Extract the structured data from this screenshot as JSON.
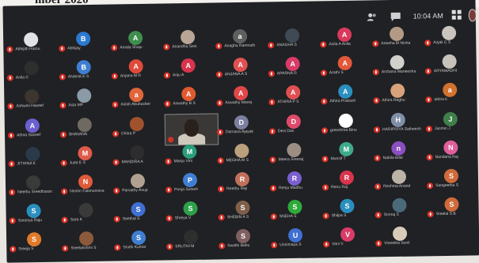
{
  "header_fragment": "mber 2020",
  "topbar": {
    "clock": "10:04 AM",
    "icons": [
      "people-icon",
      "chat-icon",
      "grid-icon"
    ]
  },
  "participants": [
    {
      "name": "Abhijith Ramu",
      "initial": "",
      "color": "#dfe3e6"
    },
    {
      "name": "Abhijay",
      "initial": "B",
      "color": "#2b79d0"
    },
    {
      "name": "Amala Shaju",
      "initial": "A",
      "color": "#3e8e4e"
    },
    {
      "name": "Anandha Sesi",
      "initial": "",
      "color": "#b8a596"
    },
    {
      "name": "Anagha Ramnath",
      "initial": "a",
      "color": "#5f5f5f"
    },
    {
      "name": "ANAGHA S",
      "initial": "",
      "color": "#3f4a55"
    },
    {
      "name": "Anila A Anila",
      "initial": "A",
      "color": "#d93a5c"
    },
    {
      "name": "Aneeha M Nisha",
      "initial": "",
      "color": "#b39a85"
    },
    {
      "name": "Anjali C S",
      "initial": "",
      "color": "#c9c4bd"
    },
    {
      "name": "Anila C",
      "initial": "",
      "color": "#2e2e2e"
    },
    {
      "name": "ANAHA K S",
      "initial": "B",
      "color": "#3f7fd1"
    },
    {
      "name": "Anjana M R",
      "initial": "A",
      "color": "#e04a3a"
    },
    {
      "name": "Anju A",
      "initial": "A",
      "color": "#d8344d"
    },
    {
      "name": "ANJANA A S",
      "initial": "A",
      "color": "#e05252"
    },
    {
      "name": "APARNA R",
      "initial": "A",
      "color": "#d83b67"
    },
    {
      "name": "Arathi S",
      "initial": "A",
      "color": "#e2583a"
    },
    {
      "name": "Archana Maneesha",
      "initial": "",
      "color": "#d2d0cc"
    },
    {
      "name": "ARYAMADHI",
      "initial": "",
      "color": "#c7c2ba"
    },
    {
      "name": "Ashwini Haseef",
      "initial": "",
      "color": "#3c3530"
    },
    {
      "name": "Asla MP",
      "initial": "",
      "color": "#8a9aa6"
    },
    {
      "name": "Aslah Abubucker",
      "initial": "a",
      "color": "#e0663a"
    },
    {
      "name": "Aswathy B S",
      "initial": "A",
      "color": "#e05a30"
    },
    {
      "name": "Aswathy Manoj",
      "initial": "A",
      "color": "#e04848"
    },
    {
      "name": "ATHIRA P S",
      "initial": "A",
      "color": "#e05050"
    },
    {
      "name": "Athira Prakash",
      "initial": "A",
      "color": "#2a8fbf"
    },
    {
      "name": "Athira Reghu",
      "initial": "",
      "color": "#d9a27a"
    },
    {
      "name": "athira k",
      "initial": "a",
      "color": "#d2722f"
    },
    {
      "name": "Athira Saseef",
      "initial": "A",
      "color": "#6b5fd1"
    },
    {
      "name": "BHAVANA",
      "initial": "",
      "color": "#6e6a62"
    },
    {
      "name": "Chitra P",
      "initial": "",
      "color": "#a0522d"
    },
    {
      "name": "",
      "initial": "",
      "color": "",
      "video": true
    },
    {
      "name": "Darsana Ajayak",
      "initial": "D",
      "color": "#7c7fa0"
    },
    {
      "name": "Devi Das",
      "initial": "D",
      "color": "#e04a6a"
    },
    {
      "name": "greeshma Binu",
      "initial": "",
      "color": "#ffffff"
    },
    {
      "name": "HARIPRIYA Satheesh",
      "initial": "H",
      "color": "#7f8fa7"
    },
    {
      "name": "Jasmin J",
      "initial": "J",
      "color": "#3f7f4a"
    },
    {
      "name": "JITHINA K",
      "initial": "",
      "color": "#2a3a4a"
    },
    {
      "name": "Juda E S",
      "initial": "M",
      "color": "#e05a4a"
    },
    {
      "name": "MANDIRA A",
      "initial": "",
      "color": "#2d2d2d"
    },
    {
      "name": "Manju Vini",
      "initial": "M",
      "color": "#2a9f7a"
    },
    {
      "name": "MEGHA M S",
      "initial": "",
      "color": "#bba07d"
    },
    {
      "name": "Meera Sreeraj",
      "initial": "",
      "color": "#9c8e82"
    },
    {
      "name": "Munsif T",
      "initial": "M",
      "color": "#3faa8a"
    },
    {
      "name": "Nabila Bilal",
      "initial": "n",
      "color": "#8a4fc0"
    },
    {
      "name": "Nandana Raj",
      "initial": "N",
      "color": "#e05f9a"
    },
    {
      "name": "Neethu Sreedharan",
      "initial": "",
      "color": "#3a3a3a"
    },
    {
      "name": "Noorin Fatimunnisa",
      "initial": "N",
      "color": "#e05a3a"
    },
    {
      "name": "Parvathy Anup",
      "initial": "",
      "color": "#b0a090"
    },
    {
      "name": "Pooja Suresh",
      "initial": "P",
      "color": "#3f7fd1"
    },
    {
      "name": "Reethu Reji",
      "initial": "R",
      "color": "#c0705a"
    },
    {
      "name": "Renju Madhu",
      "initial": "R",
      "color": "#7a5fd1"
    },
    {
      "name": "Renu Raj",
      "initial": "R",
      "color": "#d8344d"
    },
    {
      "name": "Reshma Anand",
      "initial": "",
      "color": "#bbb3a6"
    },
    {
      "name": "Sangeetha S",
      "initial": "S",
      "color": "#d06a3a"
    },
    {
      "name": "Saranya Raju",
      "initial": "S",
      "color": "#2a8fbf"
    },
    {
      "name": "Sara K",
      "initial": "",
      "color": "#3a3a3a"
    },
    {
      "name": "Seethal S",
      "initial": "S",
      "color": "#3f6fd1"
    },
    {
      "name": "Shreya V",
      "initial": "S",
      "color": "#2e9f4a"
    },
    {
      "name": "SHEBIN A S",
      "initial": "S",
      "color": "#7f5f4a"
    },
    {
      "name": "SNEHA S",
      "initial": "S",
      "color": "#2eaa3a"
    },
    {
      "name": "Shilpa S",
      "initial": "S",
      "color": "#2a8fbf"
    },
    {
      "name": "Sooraj S",
      "initial": "",
      "color": "#4a6a7a"
    },
    {
      "name": "Sreelal S B",
      "initial": "S",
      "color": "#d06a3a"
    },
    {
      "name": "Sreeja S",
      "initial": "S",
      "color": "#e07a2a"
    },
    {
      "name": "Sreelakshmi S",
      "initial": "",
      "color": "#8a5a3a"
    },
    {
      "name": "Sruthi Kumar",
      "initial": "S",
      "color": "#3f7fd1"
    },
    {
      "name": "SRUTHI M",
      "initial": "",
      "color": "#2e2e2e"
    },
    {
      "name": "Swathi Babu",
      "initial": "S",
      "color": "#7f5f5f"
    },
    {
      "name": "Unnimaya S",
      "initial": "U",
      "color": "#3f6fd1"
    },
    {
      "name": "Vani V",
      "initial": "V",
      "color": "#d83b67"
    },
    {
      "name": "Vineetha Sunil",
      "initial": "",
      "color": "#d8ccb8"
    },
    {
      "name": "",
      "initial": "",
      "color": ""
    }
  ]
}
